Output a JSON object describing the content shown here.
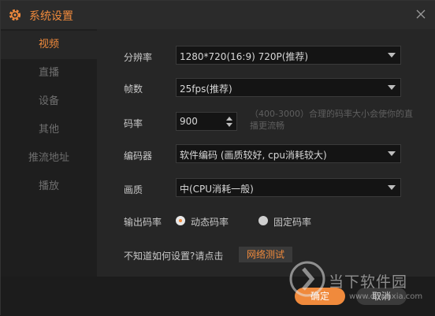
{
  "window": {
    "title": "系统设置"
  },
  "sidebar": {
    "items": [
      {
        "label": "视频",
        "active": true
      },
      {
        "label": "直播",
        "active": false
      },
      {
        "label": "设备",
        "active": false
      },
      {
        "label": "其他",
        "active": false
      },
      {
        "label": "推流地址",
        "active": false
      },
      {
        "label": "播放",
        "active": false
      }
    ]
  },
  "settings": {
    "resolution": {
      "label": "分辨率",
      "value": "1280*720(16:9) 720P(推荐)"
    },
    "fps": {
      "label": "帧数",
      "value": "25fps(推荐)"
    },
    "bitrate": {
      "label": "码率",
      "value": "900",
      "hint": "（400-3000）合理的码率大小会使你的直播更流畅"
    },
    "encoder": {
      "label": "编码器",
      "value": "软件编码 (画质较好, cpu消耗较大)"
    },
    "quality": {
      "label": "画质",
      "value": "中(CPU消耗一般)"
    },
    "output_bitrate": {
      "label": "输出码率",
      "options": [
        {
          "label": "动态码率",
          "selected": true
        },
        {
          "label": "固定码率",
          "selected": false
        }
      ]
    },
    "help": {
      "text": "不知道如何设置?请点击",
      "button": "网络测试"
    }
  },
  "footer": {
    "ok_label": "确定",
    "cancel_label": "取消"
  },
  "watermark": {
    "title": "当下软件园",
    "url": "www.downxia.com"
  },
  "colors": {
    "accent": "#f08a3c",
    "background": "#262626",
    "sidebar": "#1e1e1e",
    "input": "#141414"
  },
  "icons": {
    "title": "gear-icon",
    "close": "close-icon",
    "dropdown": "chevron-down-icon"
  }
}
